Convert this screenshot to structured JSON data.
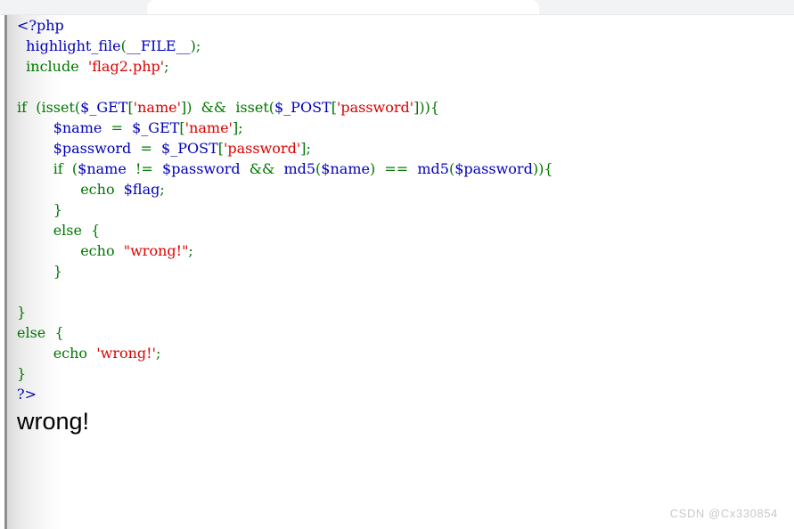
{
  "browser": {
    "tab_present": true,
    "tab_label": ""
  },
  "colors": {
    "php_default": "#0000BB",
    "php_keyword": "#007700",
    "php_string": "#DD0000",
    "php_comment": "#FF8000",
    "page_background": "#FFFFFF",
    "chrome_background": "#F1F3F4",
    "gutter_rule": "#8E8E8E",
    "output_text": "#000000",
    "watermark_text": "#C9C9C9"
  },
  "source": {
    "language": "php",
    "rendered_by": "highlight_file",
    "lines": [
      [
        {
          "t": "<?php",
          "c": "default"
        }
      ],
      [
        {
          "t": "  ",
          "c": "keyword"
        },
        {
          "t": "highlight_file",
          "c": "default"
        },
        {
          "t": "(",
          "c": "keyword"
        },
        {
          "t": "__FILE__",
          "c": "default"
        },
        {
          "t": ")",
          "c": "keyword"
        },
        {
          "t": ";",
          "c": "keyword"
        }
      ],
      [
        {
          "t": "  ",
          "c": "keyword"
        },
        {
          "t": "include",
          "c": "keyword"
        },
        {
          "t": "  ",
          "c": "keyword"
        },
        {
          "t": "'flag2.php'",
          "c": "string"
        },
        {
          "t": ";",
          "c": "keyword"
        }
      ],
      [
        {
          "t": "",
          "c": "keyword"
        }
      ],
      [
        {
          "t": "if",
          "c": "keyword"
        },
        {
          "t": "  (",
          "c": "keyword"
        },
        {
          "t": "isset",
          "c": "keyword"
        },
        {
          "t": "(",
          "c": "keyword"
        },
        {
          "t": "$_GET",
          "c": "default"
        },
        {
          "t": "[",
          "c": "keyword"
        },
        {
          "t": "'name'",
          "c": "string"
        },
        {
          "t": "])",
          "c": "keyword"
        },
        {
          "t": "  ",
          "c": "keyword"
        },
        {
          "t": "&&",
          "c": "keyword"
        },
        {
          "t": "  ",
          "c": "keyword"
        },
        {
          "t": "isset",
          "c": "keyword"
        },
        {
          "t": "(",
          "c": "keyword"
        },
        {
          "t": "$_POST",
          "c": "default"
        },
        {
          "t": "[",
          "c": "keyword"
        },
        {
          "t": "'password'",
          "c": "string"
        },
        {
          "t": "]))",
          "c": "keyword"
        },
        {
          "t": "{",
          "c": "keyword"
        }
      ],
      [
        {
          "t": "        ",
          "c": "keyword"
        },
        {
          "t": "$name",
          "c": "default"
        },
        {
          "t": "  ",
          "c": "keyword"
        },
        {
          "t": "=",
          "c": "keyword"
        },
        {
          "t": "  ",
          "c": "keyword"
        },
        {
          "t": "$_GET",
          "c": "default"
        },
        {
          "t": "[",
          "c": "keyword"
        },
        {
          "t": "'name'",
          "c": "string"
        },
        {
          "t": "]",
          "c": "keyword"
        },
        {
          "t": ";",
          "c": "keyword"
        }
      ],
      [
        {
          "t": "        ",
          "c": "keyword"
        },
        {
          "t": "$password",
          "c": "default"
        },
        {
          "t": "  ",
          "c": "keyword"
        },
        {
          "t": "=",
          "c": "keyword"
        },
        {
          "t": "  ",
          "c": "keyword"
        },
        {
          "t": "$_POST",
          "c": "default"
        },
        {
          "t": "[",
          "c": "keyword"
        },
        {
          "t": "'password'",
          "c": "string"
        },
        {
          "t": "]",
          "c": "keyword"
        },
        {
          "t": ";",
          "c": "keyword"
        }
      ],
      [
        {
          "t": "        ",
          "c": "keyword"
        },
        {
          "t": "if",
          "c": "keyword"
        },
        {
          "t": "  (",
          "c": "keyword"
        },
        {
          "t": "$name",
          "c": "default"
        },
        {
          "t": "  ",
          "c": "keyword"
        },
        {
          "t": "!=",
          "c": "keyword"
        },
        {
          "t": "  ",
          "c": "keyword"
        },
        {
          "t": "$password",
          "c": "default"
        },
        {
          "t": "  ",
          "c": "keyword"
        },
        {
          "t": "&&",
          "c": "keyword"
        },
        {
          "t": "  ",
          "c": "keyword"
        },
        {
          "t": "md5",
          "c": "default"
        },
        {
          "t": "(",
          "c": "keyword"
        },
        {
          "t": "$name",
          "c": "default"
        },
        {
          "t": ")",
          "c": "keyword"
        },
        {
          "t": "  ",
          "c": "keyword"
        },
        {
          "t": "==",
          "c": "keyword"
        },
        {
          "t": "  ",
          "c": "keyword"
        },
        {
          "t": "md5",
          "c": "default"
        },
        {
          "t": "(",
          "c": "keyword"
        },
        {
          "t": "$password",
          "c": "default"
        },
        {
          "t": "))",
          "c": "keyword"
        },
        {
          "t": "{",
          "c": "keyword"
        }
      ],
      [
        {
          "t": "              ",
          "c": "keyword"
        },
        {
          "t": "echo",
          "c": "keyword"
        },
        {
          "t": "  ",
          "c": "keyword"
        },
        {
          "t": "$flag",
          "c": "default"
        },
        {
          "t": ";",
          "c": "keyword"
        }
      ],
      [
        {
          "t": "        ",
          "c": "keyword"
        },
        {
          "t": "}",
          "c": "keyword"
        }
      ],
      [
        {
          "t": "        ",
          "c": "keyword"
        },
        {
          "t": "else",
          "c": "keyword"
        },
        {
          "t": "  {",
          "c": "keyword"
        }
      ],
      [
        {
          "t": "              ",
          "c": "keyword"
        },
        {
          "t": "echo",
          "c": "keyword"
        },
        {
          "t": "  ",
          "c": "keyword"
        },
        {
          "t": "\"wrong!\"",
          "c": "string"
        },
        {
          "t": ";",
          "c": "keyword"
        }
      ],
      [
        {
          "t": "        ",
          "c": "keyword"
        },
        {
          "t": "}",
          "c": "keyword"
        }
      ],
      [
        {
          "t": "",
          "c": "keyword"
        }
      ],
      [
        {
          "t": "}",
          "c": "keyword"
        }
      ],
      [
        {
          "t": "else",
          "c": "keyword"
        },
        {
          "t": "  {",
          "c": "keyword"
        }
      ],
      [
        {
          "t": "        ",
          "c": "keyword"
        },
        {
          "t": "echo",
          "c": "keyword"
        },
        {
          "t": "  ",
          "c": "keyword"
        },
        {
          "t": "'wrong!'",
          "c": "string"
        },
        {
          "t": ";",
          "c": "keyword"
        }
      ],
      [
        {
          "t": "}",
          "c": "keyword"
        }
      ],
      [
        {
          "t": "?>",
          "c": "default"
        }
      ]
    ]
  },
  "output": {
    "text": "wrong!"
  },
  "watermark": {
    "text": "CSDN @Cx330854"
  }
}
